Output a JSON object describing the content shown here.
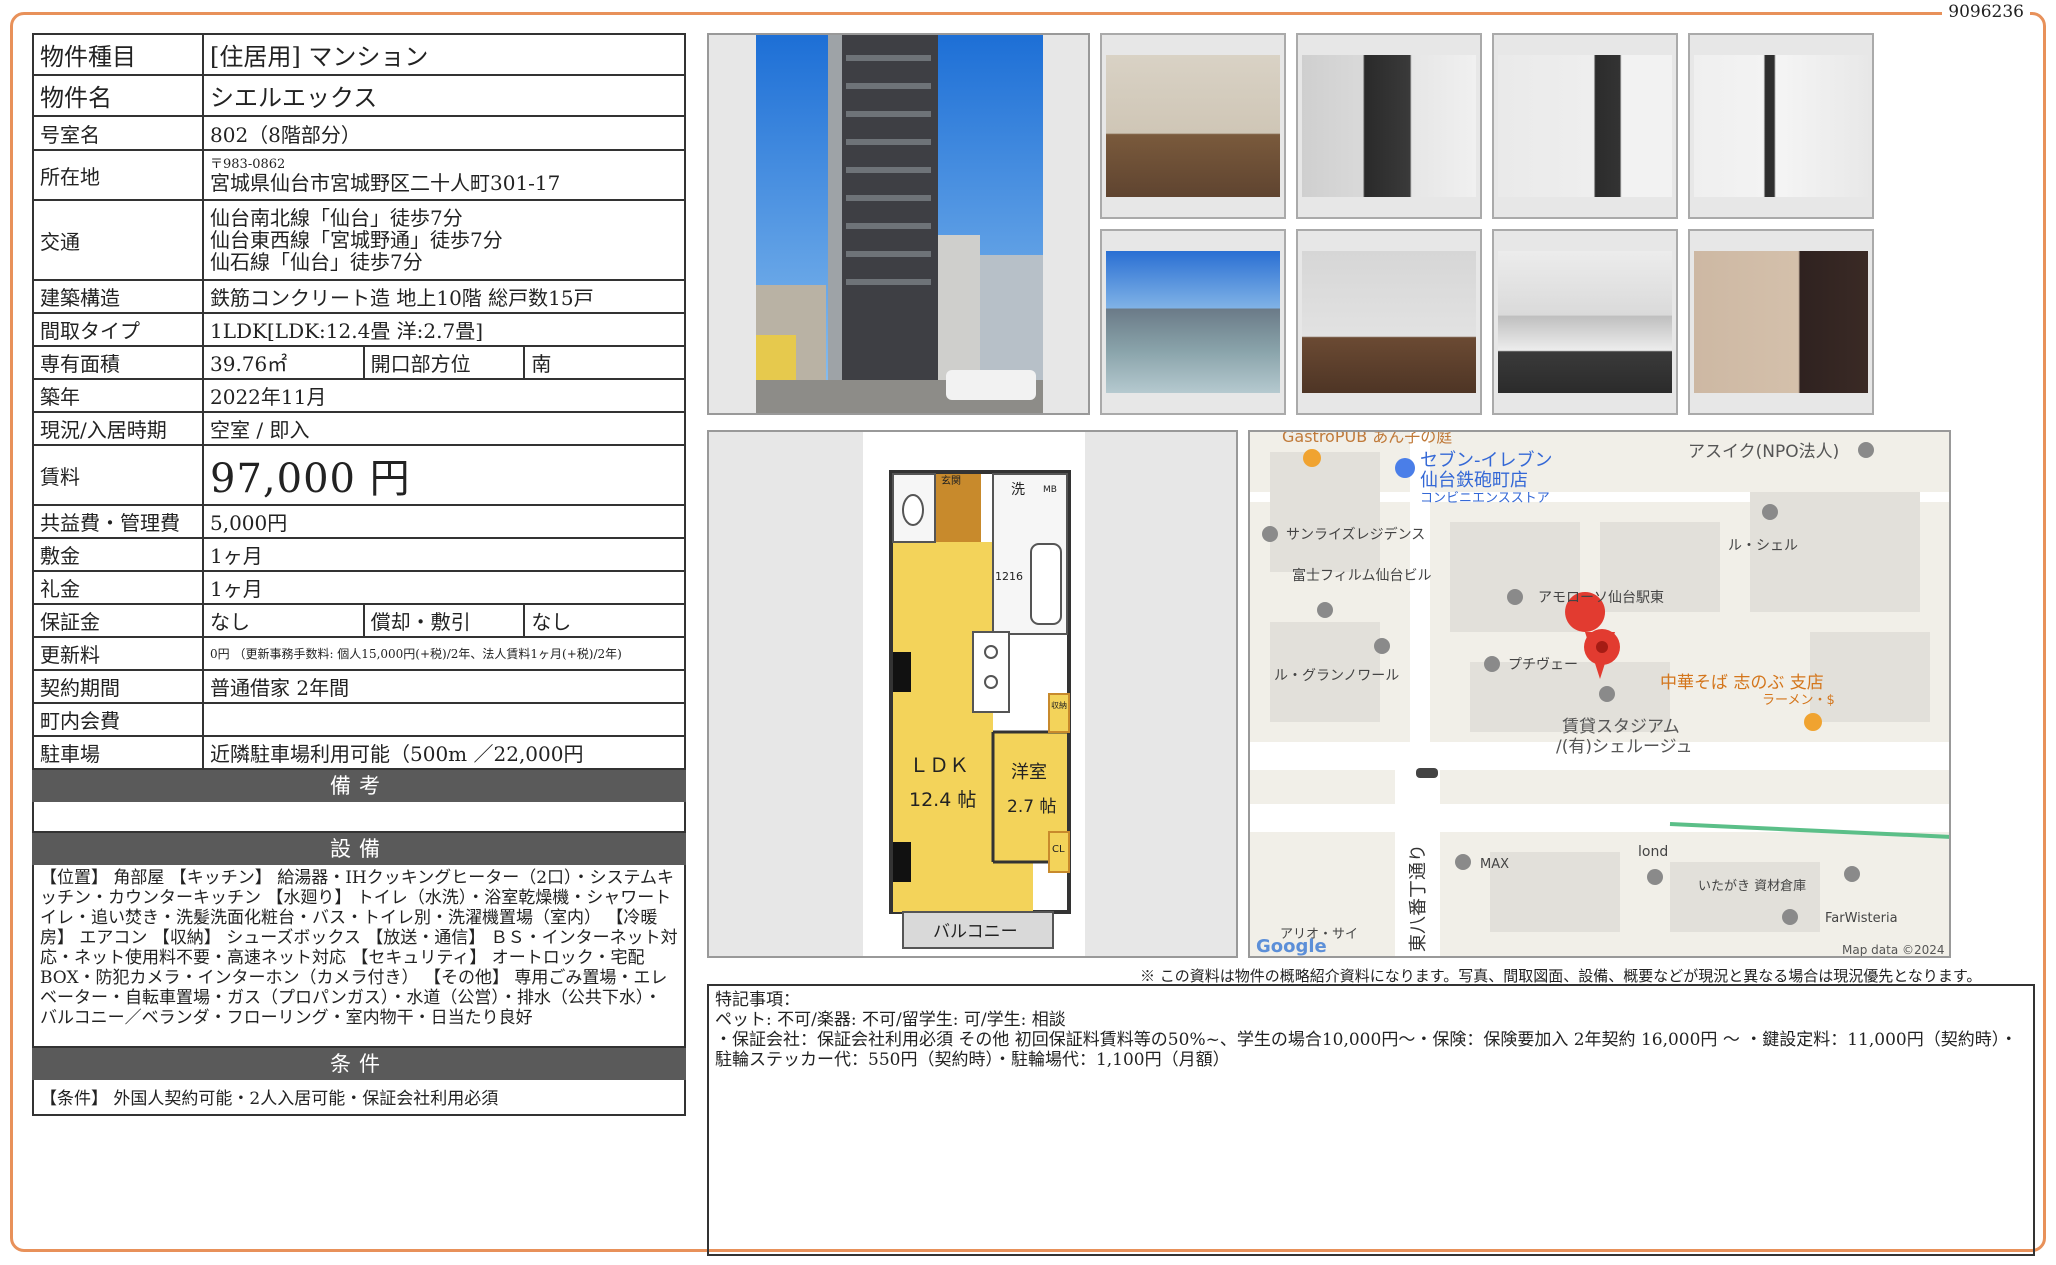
{
  "doc_id": "9096236",
  "spec": {
    "type_label": "物件種目",
    "type_value": "[住居用]  マンション",
    "name_label": "物件名",
    "name_value": "シエルエックス",
    "room_label": "号室名",
    "room_value": "802（8階部分）",
    "addr_label": "所在地",
    "addr_zip": "〒983-0862",
    "addr_value": "宮城県仙台市宮城野区二十人町301-17",
    "traffic_label": "交通",
    "traffic": [
      "仙台南北線「仙台」徒歩7分",
      "仙台東西線「宮城野通」徒歩7分",
      "仙石線「仙台」徒歩7分"
    ],
    "structure_label": "建築構造",
    "structure_value": "鉄筋コンクリート造  地上10階  総戸数15戸",
    "layout_label": "間取タイプ",
    "layout_value": "1LDK[LDK:12.4畳  洋:2.7畳]",
    "area_label": "専有面積",
    "area_value": "39.76㎡",
    "direction_label": "開口部方位",
    "direction_value": "南",
    "built_label": "築年",
    "built_value": "2022年11月",
    "status_label": "現況/入居時期",
    "status_value": "空室  /  即入",
    "rent_label": "賃料",
    "rent_value": "97,000 円",
    "fee_label": "共益費・管理費",
    "fee_value": "5,000円",
    "deposit_label": "敷金",
    "deposit_value": "1ヶ月",
    "key_money_label": "礼金",
    "key_money_value": "1ヶ月",
    "guarantee_label": "保証金",
    "guarantee_value": "なし",
    "amort_label": "償却・敷引",
    "amort_value": "なし",
    "renewal_label": "更新料",
    "renewal_value": "0円  （更新事務手数料: 個人15,000円(+税)/2年、法人賃料1ヶ月(+税)/2年)",
    "contract_label": "契約期間",
    "contract_value": "普通借家  2年間",
    "town_label": "町内会費",
    "town_value": "",
    "parking_label": "駐車場",
    "parking_value": "近隣駐車場利用可能（500m  ／22,000円",
    "bikou_header": "備考",
    "setsubi_header": "設備",
    "facilities": "【位置】 角部屋 【キッチン】 給湯器・IHクッキングヒーター（2口）・システムキッチン・カウンターキッチン 【水廻り】 トイレ（水洗）・浴室乾燥機・シャワートイレ・追い焚き・洗髪洗面化粧台・バス・トイレ別・洗濯機置場（室内） 【冷暖房】 エアコン 【収納】 シューズボックス 【放送・通信】 ＢＳ・インターネット対応・ネット使用料不要・高速ネット対応 【セキュリティ】 オートロック・宅配BOX・防犯カメラ・インターホン（カメラ付き） 【その他】 専用ごみ置場・エレベーター・自転車置場・ガス（プロパンガス）・水道（公営）・排水（公共下水）・バルコニー／ベランダ・フローリング・室内物干・日当たり良好",
    "jouken_header": "条件",
    "conditions": "【条件】 外国人契約可能・2人入居可能・保証会社利用必須"
  },
  "floorplan": {
    "genkan": "玄関",
    "sen": "洗",
    "mb": "MB",
    "num": "1216",
    "ldk": "ＬＤＫ",
    "ldk_size": "12.4 帖",
    "youshitsu": "洋室",
    "you_size": "2.7 帖",
    "shuno": "収納",
    "cl": "CL",
    "balcony": "バルコニー"
  },
  "map": {
    "labels": {
      "gastro": "GastroPUB あん子の庭",
      "seven": "セブン-イレブン",
      "seven2": "仙台鉄砲町店",
      "seven3": "コンビニエンスストア",
      "asuiku": "アスイク(NPO法人)",
      "sunrise": "サンライズレジデンス",
      "fuji": "富士フィルム仙台ビル",
      "lushell": "ル・シェル",
      "amoroso": "アモローソ仙台駅東",
      "grand": "ル・グランノワール",
      "puchi": "プチヴェー",
      "chuka": "中華そば 志のぶ 支店",
      "ramen": "ラーメン・$",
      "chintai": "賃貸スタジアム",
      "chintai2": "/(有)シェルージュ",
      "street": "東八番丁通り",
      "max": "MAX",
      "lond": "lond",
      "itagaki": "いたがき 資材倉庫",
      "farwisteria": "FarWisteria",
      "ario": "アリオ・サイ",
      "google": "Google",
      "mapdata": "Map data ©2024"
    }
  },
  "disclaimer": "※  この資料は物件の概略紹介資料になります。写真、間取図面、設備、概要などが現況と異なる場合は現況優先となります。",
  "remarks": {
    "title": "特記事項：",
    "line1": "ペット: 不可/楽器: 不可/留学生: 可/学生: 相談",
    "line2": "・保証会社：保証会社利用必須  その他  初回保証料賃料等の50%~、学生の場合10,000円〜・保険：保険要加入  2年契約  16,000円  〜  ・鍵設定料：11,000円（契約時）・駐輪ステッカー代：550円（契約時）・駐輪場代：1,100円（月額）"
  }
}
